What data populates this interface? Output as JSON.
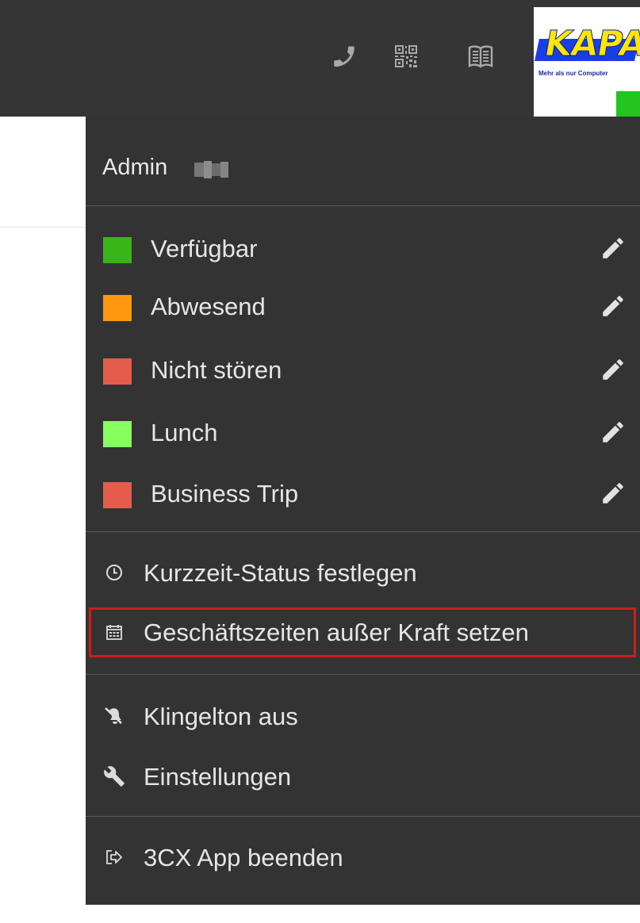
{
  "header": {
    "icons": [
      "phone-icon",
      "qr-code-icon",
      "phonebook-icon"
    ],
    "logo": {
      "text": "KAPA",
      "tagline": "Mehr als nur Computer"
    }
  },
  "user_menu": {
    "user_name": "Admin",
    "statuses": [
      {
        "label": "Verfügbar",
        "color": "#38b518"
      },
      {
        "label": "Abwesend",
        "color": "#ff980e"
      },
      {
        "label": "Nicht stören",
        "color": "#e55c4d"
      },
      {
        "label": "Lunch",
        "color": "#87ff5e"
      },
      {
        "label": "Business Trip",
        "color": "#e55c4d"
      }
    ],
    "actions": {
      "short_status": "Kurzzeit-Status festlegen",
      "override_hours": "Geschäftszeiten außer Kraft setzen",
      "ringtone_off": "Klingelton aus",
      "settings": "Einstellungen",
      "quit": "3CX App beenden"
    },
    "highlight_color": "#d11b1b"
  }
}
